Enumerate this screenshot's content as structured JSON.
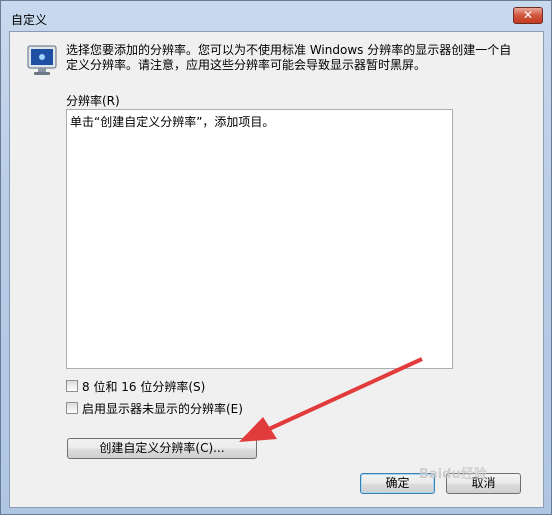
{
  "window": {
    "title": "自定义",
    "close_label": "✕"
  },
  "description": "选择您要添加的分辨率。您可以为不使用标准 Windows 分辨率的显示器创建一个自定义分辨率。请注意，应用这些分辨率可能会导致显示器暂时黑屏。",
  "resolution_list": {
    "label": "分辨率(R)",
    "items": [
      "单击“创建自定义分辨率”，添加项目。"
    ]
  },
  "checkboxes": [
    {
      "label": "8 位和 16 位分辨率(S)",
      "checked": false
    },
    {
      "label": "启用显示器未显示的分辨率(E)",
      "checked": false
    }
  ],
  "buttons": {
    "create_custom": "创建自定义分辨率(C)...",
    "ok": "确定",
    "cancel": "取消"
  },
  "annotation": {
    "arrow_color": "#e23b3b",
    "watermark": "Baidu经验"
  }
}
